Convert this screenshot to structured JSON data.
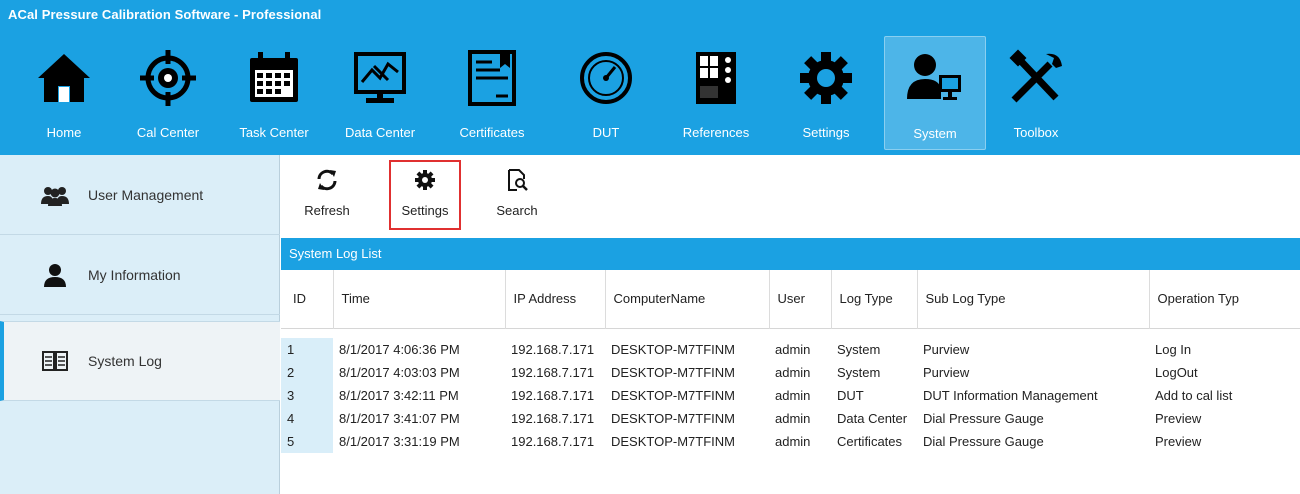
{
  "app": {
    "title": "ACal Pressure Calibration Software -  Professional"
  },
  "nav": {
    "items": [
      {
        "label": "Home",
        "icon": "home-icon"
      },
      {
        "label": "Cal Center",
        "icon": "target-icon"
      },
      {
        "label": "Task Center",
        "icon": "calendar-icon"
      },
      {
        "label": "Data Center",
        "icon": "chart-monitor-icon"
      },
      {
        "label": "Certificates",
        "icon": "certificate-icon"
      },
      {
        "label": "DUT",
        "icon": "gauge-icon"
      },
      {
        "label": "References",
        "icon": "device-icon"
      },
      {
        "label": "Settings",
        "icon": "gear-icon"
      },
      {
        "label": "System",
        "icon": "user-computer-icon"
      },
      {
        "label": "Toolbox",
        "icon": "tools-icon"
      }
    ],
    "active": "System"
  },
  "sidebar": {
    "items": [
      {
        "label": "User Management",
        "icon": "users-icon"
      },
      {
        "label": "My Information",
        "icon": "user-icon"
      },
      {
        "label": "System Log",
        "icon": "book-icon"
      }
    ],
    "active": "System Log"
  },
  "toolbar": {
    "refresh_label": "Refresh",
    "settings_label": "Settings",
    "search_label": "Search"
  },
  "log_list": {
    "title": "System Log List",
    "columns": [
      "ID",
      "Time",
      "IP Address",
      "ComputerName",
      "User",
      "Log Type",
      "Sub Log Type",
      "Operation Typ"
    ],
    "rows": [
      [
        "1",
        "8/1/2017 4:06:36 PM",
        "192.168.7.171",
        "DESKTOP-M7TFINM",
        "admin",
        "System",
        "Purview",
        "Log In"
      ],
      [
        "2",
        "8/1/2017 4:03:03 PM",
        "192.168.7.171",
        "DESKTOP-M7TFINM",
        "admin",
        "System",
        "Purview",
        "LogOut"
      ],
      [
        "3",
        "8/1/2017 3:42:11 PM",
        "192.168.7.171",
        "DESKTOP-M7TFINM",
        "admin",
        "DUT",
        "DUT Information Management",
        "Add to cal list"
      ],
      [
        "4",
        "8/1/2017 3:41:07 PM",
        "192.168.7.171",
        "DESKTOP-M7TFINM",
        "admin",
        "Data Center",
        "Dial Pressure Gauge",
        "Preview"
      ],
      [
        "5",
        "8/1/2017 3:31:19 PM",
        "192.168.7.171",
        "DESKTOP-M7TFINM",
        "admin",
        "Certificates",
        "Dial Pressure Gauge",
        "Preview"
      ]
    ]
  },
  "colors": {
    "accent": "#1ba1e2",
    "sidebar_bg": "#dbeef8",
    "highlight_border": "#e03030"
  }
}
